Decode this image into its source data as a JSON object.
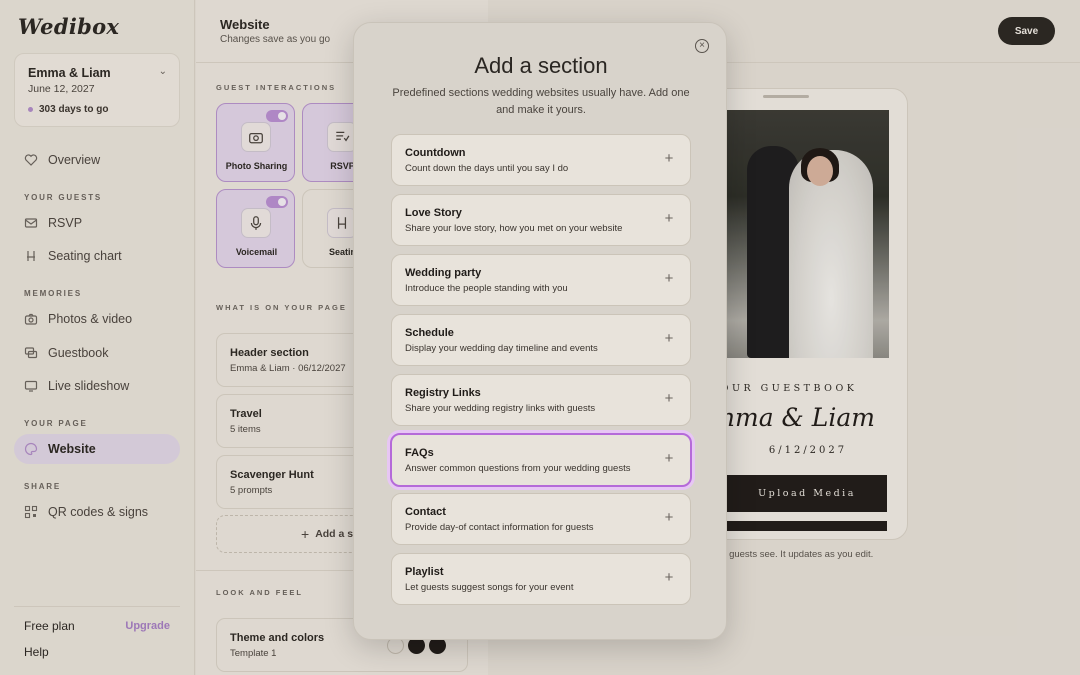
{
  "logo": "Wedibox",
  "couple": {
    "names": "Emma & Liam",
    "date": "June 12, 2027",
    "countdown": "303 days to go"
  },
  "nav": {
    "overview": "Overview",
    "sec_guests": "YOUR GUESTS",
    "rsvp": "RSVP",
    "seating": "Seating chart",
    "sec_memories": "MEMORIES",
    "photos": "Photos & video",
    "guestbook": "Guestbook",
    "slideshow": "Live slideshow",
    "sec_page": "YOUR PAGE",
    "website": "Website",
    "sec_share": "SHARE",
    "qr": "QR codes & signs"
  },
  "footer": {
    "plan": "Free plan",
    "upgrade": "Upgrade",
    "help": "Help"
  },
  "header": {
    "title": "Website",
    "subtitle": "Changes save as you go",
    "save": "Save"
  },
  "guest_interactions": {
    "label": "GUEST INTERACTIONS",
    "tiles": [
      {
        "label": "Photo Sharing",
        "icon": "camera-icon"
      },
      {
        "label": "RSVP",
        "icon": "rsvp-icon"
      },
      {
        "label": "Voicemail",
        "icon": "microphone-icon"
      },
      {
        "label": "Seatin",
        "icon": "seat-icon"
      }
    ]
  },
  "page_sections": {
    "label": "WHAT IS ON YOUR PAGE",
    "items": [
      {
        "title": "Header section",
        "sub": "Emma & Liam · 06/12/2027"
      },
      {
        "title": "Travel",
        "sub": "5 items"
      },
      {
        "title": "Scavenger Hunt",
        "sub": "5 prompts"
      }
    ],
    "add": "Add a s"
  },
  "look": {
    "label": "LOOK AND FEEL",
    "title": "Theme and colors",
    "sub": "Template 1"
  },
  "preview": {
    "guestbook": "OUR GUESTBOOK",
    "names": "Emma & Liam",
    "date": "6/12/2027",
    "upload": "Upload Media",
    "note": "ur guests see. It updates as you edit."
  },
  "modal": {
    "title": "Add a section",
    "subtitle": "Predefined sections wedding websites usually have. Add one and make it yours.",
    "options": [
      {
        "title": "Countdown",
        "sub": "Count down the days until you say I do"
      },
      {
        "title": "Love Story",
        "sub": "Share your love story, how you met on your website"
      },
      {
        "title": "Wedding party",
        "sub": "Introduce the people standing with you"
      },
      {
        "title": "Schedule",
        "sub": "Display your wedding day timeline and events"
      },
      {
        "title": "Registry Links",
        "sub": "Share your wedding registry links with guests"
      },
      {
        "title": "FAQs",
        "sub": "Answer common questions from your wedding guests"
      },
      {
        "title": "Contact",
        "sub": "Provide day-of contact information for guests"
      },
      {
        "title": "Playlist",
        "sub": "Let guests suggest songs for your event"
      }
    ]
  },
  "colors": {
    "accent": "#b56ad9",
    "dark": "#2a2622"
  }
}
